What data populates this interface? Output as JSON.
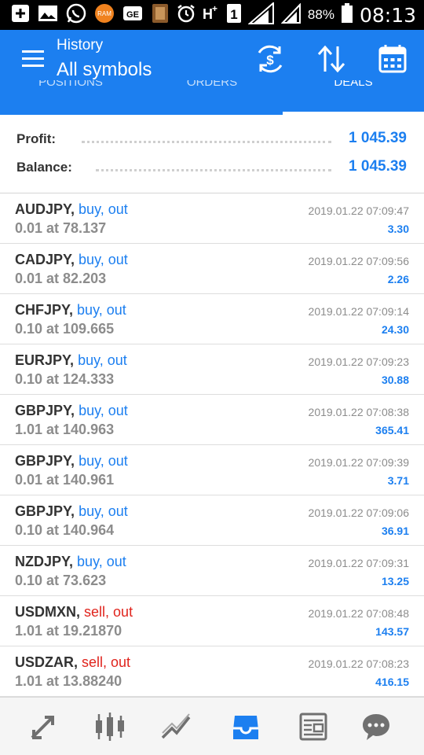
{
  "status_bar": {
    "battery_percent": "88%",
    "time": "08:13",
    "ram_badge": "RAM",
    "sim_label": "1"
  },
  "app_bar": {
    "subtitle": "History",
    "title": "All symbols",
    "accent_color": "#1c7ff0",
    "actions": [
      "currency-exchange-icon",
      "sort-icon",
      "calendar-icon"
    ]
  },
  "tabs": [
    {
      "label": "POSITIONS",
      "active": false
    },
    {
      "label": "ORDERS",
      "active": false
    },
    {
      "label": "DEALS",
      "active": true
    }
  ],
  "summary": {
    "profit_label": "Profit:",
    "profit_value": "1 045.39",
    "balance_label": "Balance:",
    "balance_value": "1 045.39"
  },
  "deals": [
    {
      "symbol": "AUDJPY,",
      "direction": "buy, out",
      "type": "buy",
      "volume": "0.01 at 78.137",
      "time": "2019.01.22 07:09:47",
      "profit": "3.30"
    },
    {
      "symbol": "CADJPY,",
      "direction": "buy, out",
      "type": "buy",
      "volume": "0.01 at 82.203",
      "time": "2019.01.22 07:09:56",
      "profit": "2.26"
    },
    {
      "symbol": "CHFJPY,",
      "direction": "buy, out",
      "type": "buy",
      "volume": "0.10 at 109.665",
      "time": "2019.01.22 07:09:14",
      "profit": "24.30"
    },
    {
      "symbol": "EURJPY,",
      "direction": "buy, out",
      "type": "buy",
      "volume": "0.10 at 124.333",
      "time": "2019.01.22 07:09:23",
      "profit": "30.88"
    },
    {
      "symbol": "GBPJPY,",
      "direction": "buy, out",
      "type": "buy",
      "volume": "1.01 at 140.963",
      "time": "2019.01.22 07:08:38",
      "profit": "365.41"
    },
    {
      "symbol": "GBPJPY,",
      "direction": "buy, out",
      "type": "buy",
      "volume": "0.01 at 140.961",
      "time": "2019.01.22 07:09:39",
      "profit": "3.71"
    },
    {
      "symbol": "GBPJPY,",
      "direction": "buy, out",
      "type": "buy",
      "volume": "0.10 at 140.964",
      "time": "2019.01.22 07:09:06",
      "profit": "36.91"
    },
    {
      "symbol": "NZDJPY,",
      "direction": "buy, out",
      "type": "buy",
      "volume": "0.10 at 73.623",
      "time": "2019.01.22 07:09:31",
      "profit": "13.25"
    },
    {
      "symbol": "USDMXN,",
      "direction": "sell, out",
      "type": "sell",
      "volume": "1.01 at 19.21870",
      "time": "2019.01.22 07:08:48",
      "profit": "143.57"
    },
    {
      "symbol": "USDZAR,",
      "direction": "sell, out",
      "type": "sell",
      "volume": "1.01 at 13.88240",
      "time": "2019.01.22 07:08:23",
      "profit": "416.15"
    }
  ],
  "bottom_nav": [
    {
      "icon": "trade-arrows-icon",
      "active": false
    },
    {
      "icon": "candlestick-chart-icon",
      "active": false
    },
    {
      "icon": "line-chart-icon",
      "active": false
    },
    {
      "icon": "history-inbox-icon",
      "active": true
    },
    {
      "icon": "news-icon",
      "active": false
    },
    {
      "icon": "chat-icon",
      "active": false
    }
  ],
  "colors": {
    "buy": "#1c7ff0",
    "sell": "#e0241d",
    "muted": "#8c8c8c",
    "nav_icon": "#707070"
  }
}
